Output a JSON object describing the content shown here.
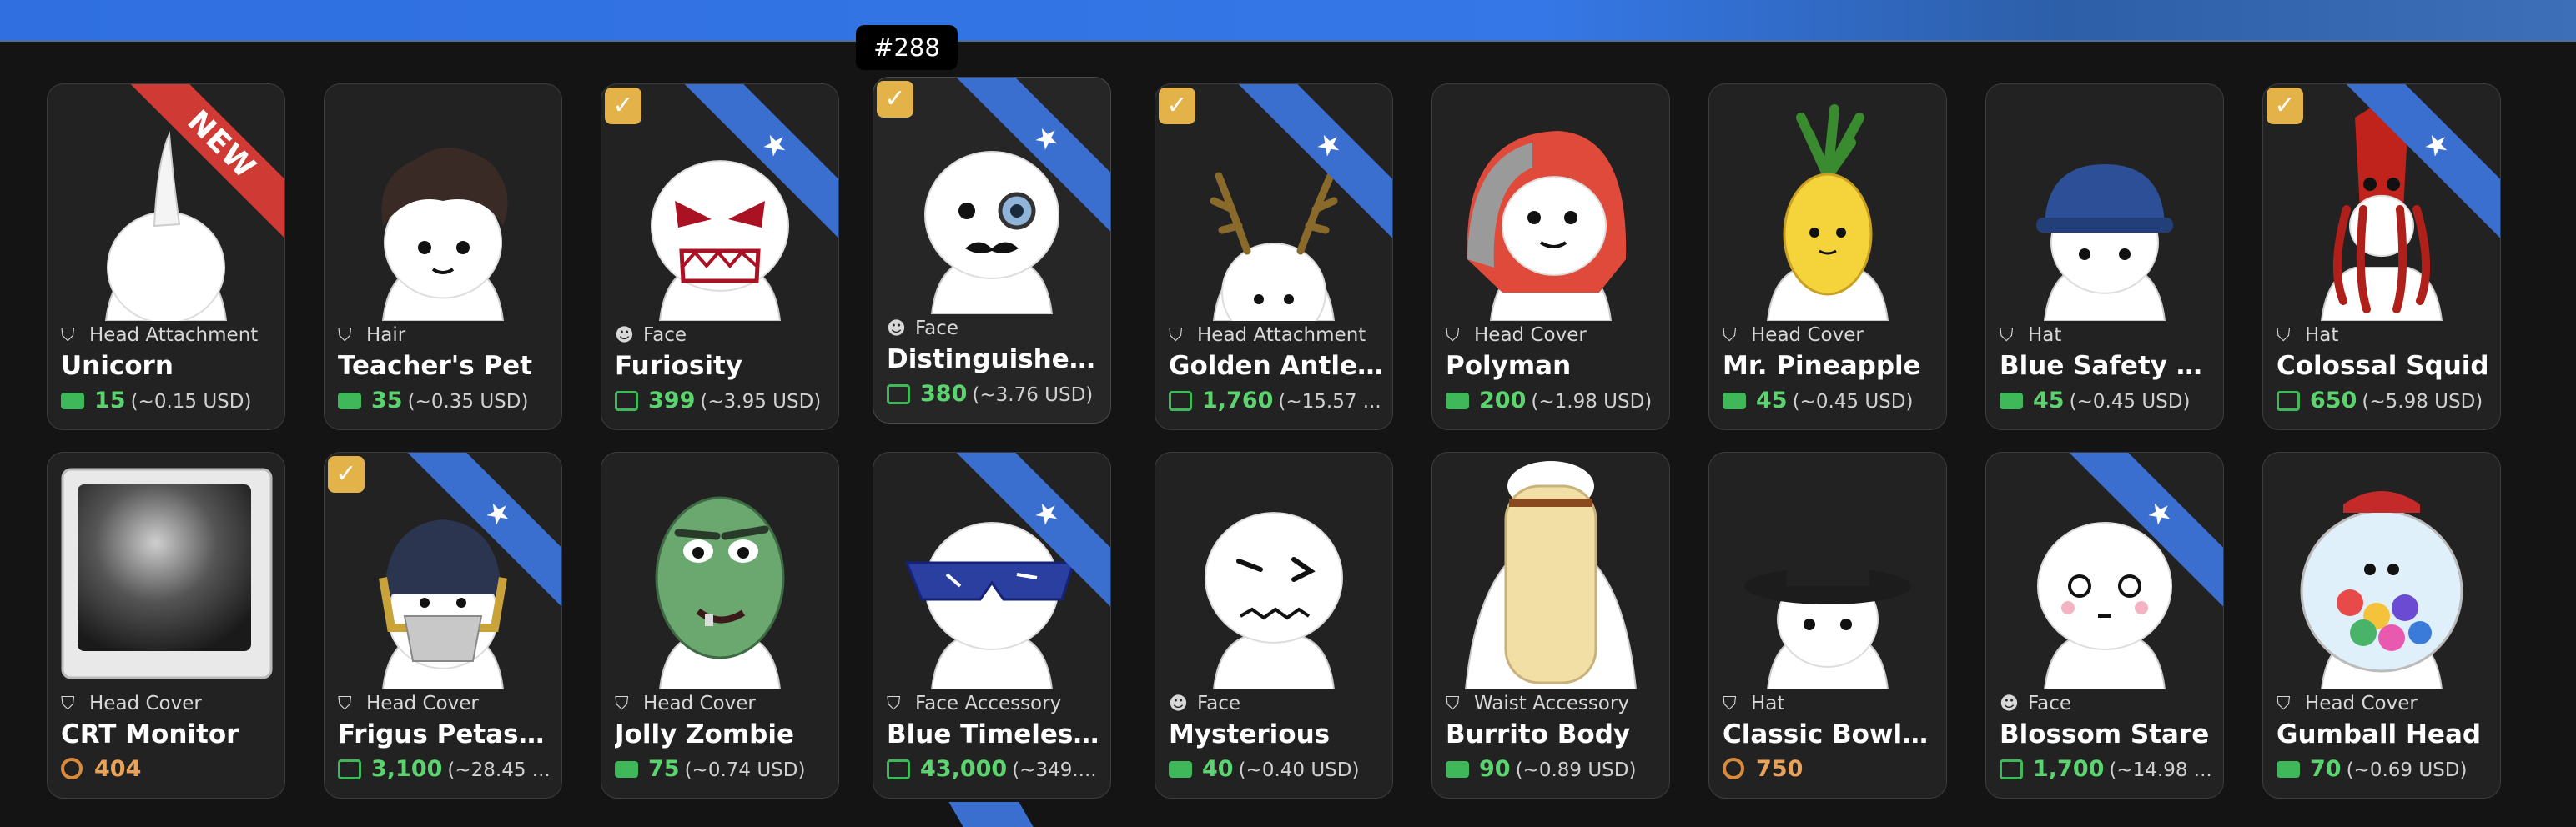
{
  "tooltip": "#288",
  "colors": {
    "accent": "#3a6fd0",
    "new_ribbon": "#cf3b34",
    "bill": "#3fb85a",
    "coin": "#d98a3a",
    "owned_check": "#e3b34a"
  },
  "ribbons": {
    "new_label": "NEW",
    "featured_symbol": "★"
  },
  "check_symbol": "✓",
  "items": [
    {
      "category": "Head Attachment",
      "category_icon": "hat-icon",
      "name": "Unicorn",
      "price": "15",
      "usd": "(~0.15 USD)",
      "price_icon": "bill-icon",
      "ribbon": "new",
      "owned": false
    },
    {
      "category": "Hair",
      "category_icon": "hat-icon",
      "name": "Teacher's Pet",
      "price": "35",
      "usd": "(~0.35 USD)",
      "price_icon": "bill-icon",
      "ribbon": "none",
      "owned": false
    },
    {
      "category": "Face",
      "category_icon": "smiley-icon",
      "name": "Furiosity",
      "price": "399",
      "usd": "(~3.95 USD)",
      "price_icon": "chart-icon",
      "ribbon": "star",
      "owned": true
    },
    {
      "category": "Face",
      "category_icon": "smiley-icon",
      "name": "Distinguished ...",
      "price": "380",
      "usd": "(~3.76 USD)",
      "price_icon": "chart-icon",
      "ribbon": "star",
      "owned": true
    },
    {
      "category": "Head Attachment",
      "category_icon": "hat-icon",
      "name": "Golden Antlers",
      "price": "1,760",
      "usd": "(~15.57 ...",
      "price_icon": "chart-icon",
      "ribbon": "star",
      "owned": true
    },
    {
      "category": "Head Cover",
      "category_icon": "hat-icon",
      "name": "Polyman",
      "price": "200",
      "usd": "(~1.98 USD)",
      "price_icon": "bill-icon",
      "ribbon": "none",
      "owned": false
    },
    {
      "category": "Head Cover",
      "category_icon": "hat-icon",
      "name": "Mr. Pineapple",
      "price": "45",
      "usd": "(~0.45 USD)",
      "price_icon": "bill-icon",
      "ribbon": "none",
      "owned": false
    },
    {
      "category": "Hat",
      "category_icon": "hat-icon",
      "name": "Blue Safety H...",
      "price": "45",
      "usd": "(~0.45 USD)",
      "price_icon": "bill-icon",
      "ribbon": "none",
      "owned": false
    },
    {
      "category": "Hat",
      "category_icon": "hat-icon",
      "name": "Colossal Squid",
      "price": "650",
      "usd": "(~5.98 USD)",
      "price_icon": "chart-icon",
      "ribbon": "star",
      "owned": true
    },
    {
      "category": "Head Cover",
      "category_icon": "hat-icon",
      "name": "CRT Monitor",
      "price": "404",
      "usd": "",
      "price_icon": "coin-icon",
      "ribbon": "none",
      "owned": false
    },
    {
      "category": "Head Cover",
      "category_icon": "hat-icon",
      "name": "Frigus Petasum",
      "price": "3,100",
      "usd": "(~28.45 ...",
      "price_icon": "chart-icon",
      "ribbon": "star",
      "owned": true
    },
    {
      "category": "Head Cover",
      "category_icon": "hat-icon",
      "name": "Jolly Zombie",
      "price": "75",
      "usd": "(~0.74 USD)",
      "price_icon": "bill-icon",
      "ribbon": "none",
      "owned": false
    },
    {
      "category": "Face Accessory",
      "category_icon": "hat-icon",
      "name": "Blue Timeless ...",
      "price": "43,000",
      "usd": "(~349....",
      "price_icon": "chart-icon",
      "ribbon": "star",
      "owned": false
    },
    {
      "category": "Face",
      "category_icon": "smiley-icon",
      "name": "Mysterious",
      "price": "40",
      "usd": "(~0.40 USD)",
      "price_icon": "bill-icon",
      "ribbon": "none",
      "owned": false
    },
    {
      "category": "Waist Accessory",
      "category_icon": "hat-icon",
      "name": "Burrito Body",
      "price": "90",
      "usd": "(~0.89 USD)",
      "price_icon": "bill-icon",
      "ribbon": "none",
      "owned": false
    },
    {
      "category": "Hat",
      "category_icon": "hat-icon",
      "name": "Classic Bowler...",
      "price": "750",
      "usd": "",
      "price_icon": "coin-icon",
      "ribbon": "none",
      "owned": false
    },
    {
      "category": "Face",
      "category_icon": "smiley-icon",
      "name": "Blossom Stare",
      "price": "1,700",
      "usd": "(~14.98 ...",
      "price_icon": "chart-icon",
      "ribbon": "star",
      "owned": false
    },
    {
      "category": "Head Cover",
      "category_icon": "hat-icon",
      "name": "Gumball Head",
      "price": "70",
      "usd": "(~0.69 USD)",
      "price_icon": "bill-icon",
      "ribbon": "none",
      "owned": false
    }
  ]
}
